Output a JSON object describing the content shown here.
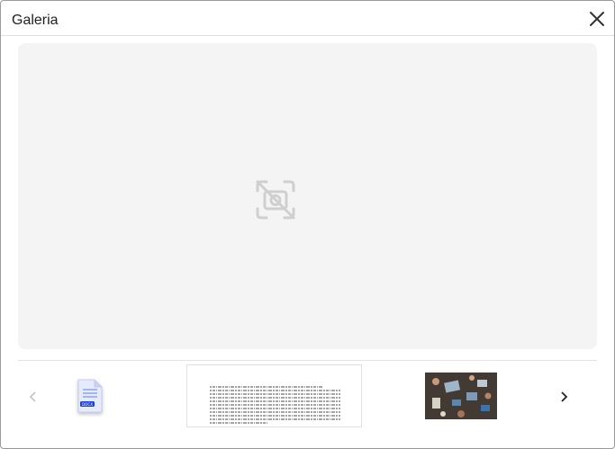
{
  "dialog": {
    "title": "Galeria"
  },
  "preview": {
    "icon": "image-unavailable-icon"
  },
  "carousel": {
    "prev_icon": "chevron-left-icon",
    "next_icon": "chevron-right-icon",
    "thumbnails": [
      {
        "kind": "document",
        "icon": "docx-file-icon",
        "badge": "DOCX"
      },
      {
        "kind": "text-page",
        "icon": "text-document-thumbnail"
      },
      {
        "kind": "photo",
        "icon": "photo-thumbnail"
      }
    ]
  },
  "colors": {
    "doc_badge": "#1e40e0",
    "doc_page": "#e6ebfb",
    "preview_bg": "#f4f4f4"
  }
}
